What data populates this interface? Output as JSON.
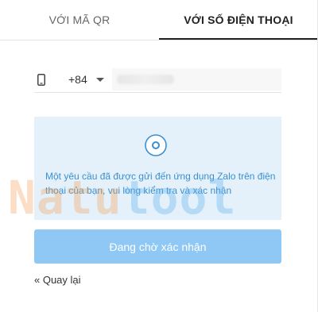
{
  "tabs": [
    {
      "label": "VỚI MÃ QR",
      "active": false
    },
    {
      "label": "VỚI SỐ ĐIỆN THOẠI",
      "active": true
    }
  ],
  "phone": {
    "icon": "mobile-phone-icon",
    "country_code": "+84",
    "dropdown_icon": "caret-down-icon",
    "number_value": ""
  },
  "notice": {
    "icon": "radio-ring-icon",
    "text": "Một yêu cầu đã được gửi đến ứng dụng Zalo trên điện thoại của bạn, vui lòng kiểm tra và xác nhận"
  },
  "wait_button": {
    "label": "Đang chờ xác nhận"
  },
  "back_link": {
    "label": "« Quay lại"
  },
  "watermark": {
    "part1": "Natu",
    "part2": "tool"
  },
  "colors": {
    "notice_bg": "#e4f1fb",
    "notice_text": "#3b8fd0",
    "button_bg": "#8fc8f5",
    "watermark_orange": "#f4a25b",
    "watermark_blue": "#5fb0ea"
  }
}
